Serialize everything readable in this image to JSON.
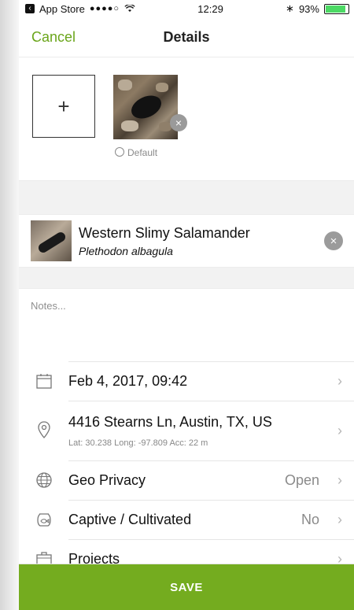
{
  "status_bar": {
    "carrier": "App Store",
    "signal": "●●●●○",
    "wifi_icon": "wifi-icon",
    "time": "12:29",
    "bluetooth": "∗",
    "battery_percent": "93%"
  },
  "nav": {
    "cancel_label": "Cancel",
    "title": "Details"
  },
  "photos": {
    "add_label": "+",
    "remove_label": "×",
    "default_label": "Default"
  },
  "species": {
    "common_name": "Western Slimy Salamander",
    "scientific_name": "Plethodon albagula",
    "clear_label": "×"
  },
  "notes": {
    "placeholder": "Notes..."
  },
  "rows": {
    "date": {
      "label": "Feb 4, 2017, 09:42",
      "chevron": "›"
    },
    "location": {
      "label": "4416 Stearns Ln, Austin, TX, US",
      "sub": "Lat: 30.238  Long: -97.809  Acc: 22 m",
      "chevron": "›"
    },
    "geo_privacy": {
      "label": "Geo Privacy",
      "value": "Open",
      "chevron": "›"
    },
    "captive": {
      "label": "Captive / Cultivated",
      "value": "No",
      "chevron": "›"
    },
    "projects": {
      "label": "Projects",
      "chevron": "›"
    }
  },
  "save": {
    "label": "SAVE"
  },
  "colors": {
    "accent": "#6aa51a",
    "save_bar": "#74ac1f"
  }
}
